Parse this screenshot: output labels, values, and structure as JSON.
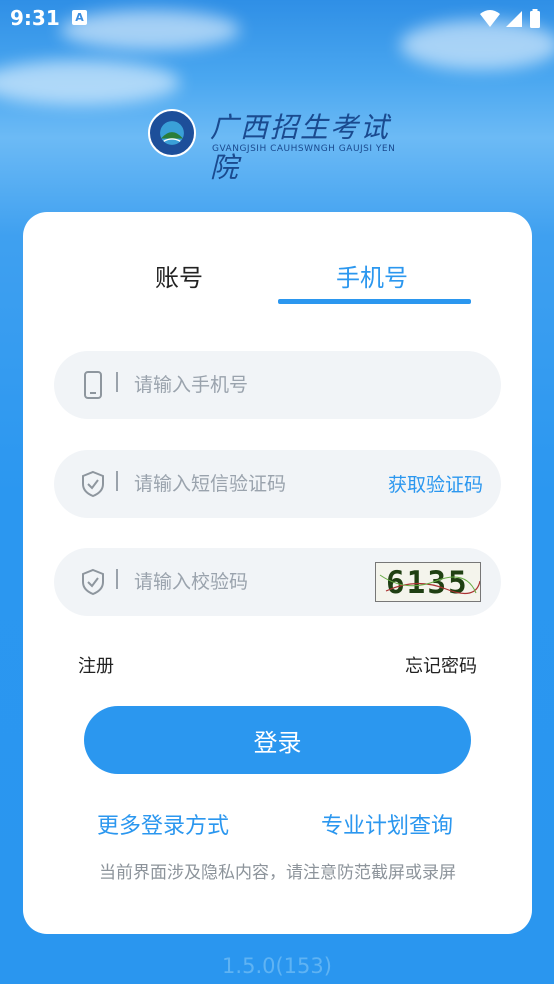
{
  "status_bar": {
    "time": "9:31",
    "notification_badge": "A"
  },
  "logo": {
    "title": "广西招生考试院",
    "subtitle": "GVANGJSIH CAUHSWNGH GAUJSI YEN"
  },
  "tabs": [
    {
      "label": "账号",
      "active": false
    },
    {
      "label": "手机号",
      "active": true
    }
  ],
  "form": {
    "phone": {
      "placeholder": "请输入手机号",
      "value": ""
    },
    "sms_code": {
      "placeholder": "请输入短信验证码",
      "value": "",
      "action_label": "获取验证码"
    },
    "verify_code": {
      "placeholder": "请输入校验码",
      "value": "",
      "captcha_text": "6135"
    }
  },
  "links": {
    "register": "注册",
    "forgot_password": "忘记密码"
  },
  "login_button": "登录",
  "more_links": {
    "more_login": "更多登录方式",
    "plan_query": "专业计划查询"
  },
  "privacy_notice": "当前界面涉及隐私内容，请注意防范截屏或录屏",
  "version": "1.5.0(153)",
  "colors": {
    "primary": "#2b97ef",
    "field_bg": "#f1f4f7",
    "placeholder": "#9aa3ad",
    "logo_text": "#1a4a8f"
  }
}
